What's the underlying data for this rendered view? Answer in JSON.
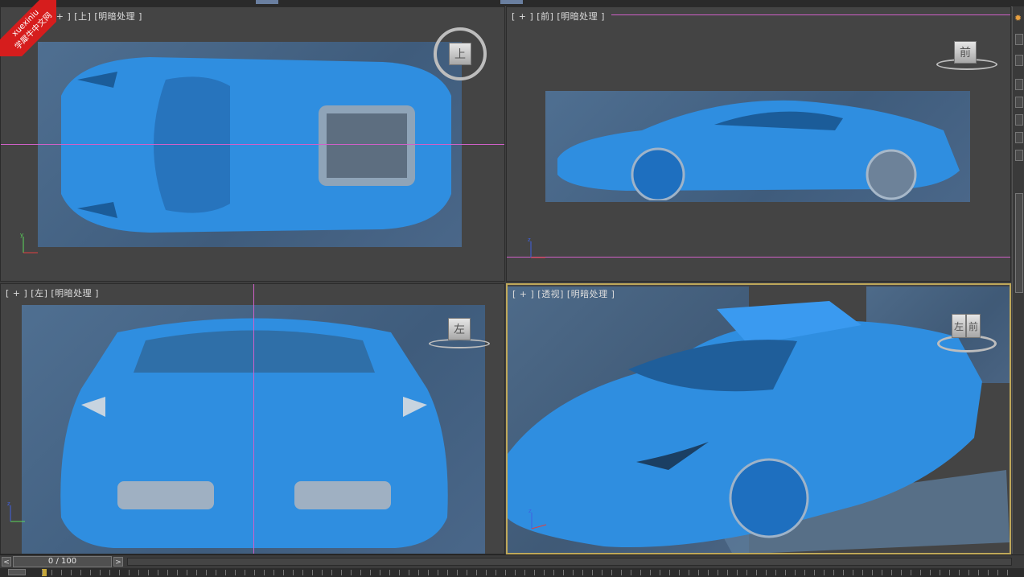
{
  "watermark": {
    "line1": "xuexiniu",
    "line2": "学犀牛中文网"
  },
  "viewports": {
    "top": {
      "label": "[ + ] [上] [明暗处理 ]",
      "nav_label": "上"
    },
    "front": {
      "label": "[ + ] [前] [明暗处理 ]",
      "nav_label": "前"
    },
    "left": {
      "label": "[ + ] [左] [明暗处理 ]",
      "nav_label": "左"
    },
    "perspective": {
      "label": "[ + ] [透视] [明暗处理 ]",
      "nav_label_left": "左",
      "nav_label_front": "前"
    }
  },
  "axes": {
    "x": "x",
    "y": "y",
    "z": "z"
  },
  "timeline": {
    "frame": "0 / 100",
    "prev": "<",
    "next": ">"
  },
  "colors": {
    "car": "#2f8ee0",
    "reference": "#4a6a8c",
    "viewport_bg": "#444444",
    "active_border": "#bfa85a",
    "grid_line": "#d060c8"
  }
}
